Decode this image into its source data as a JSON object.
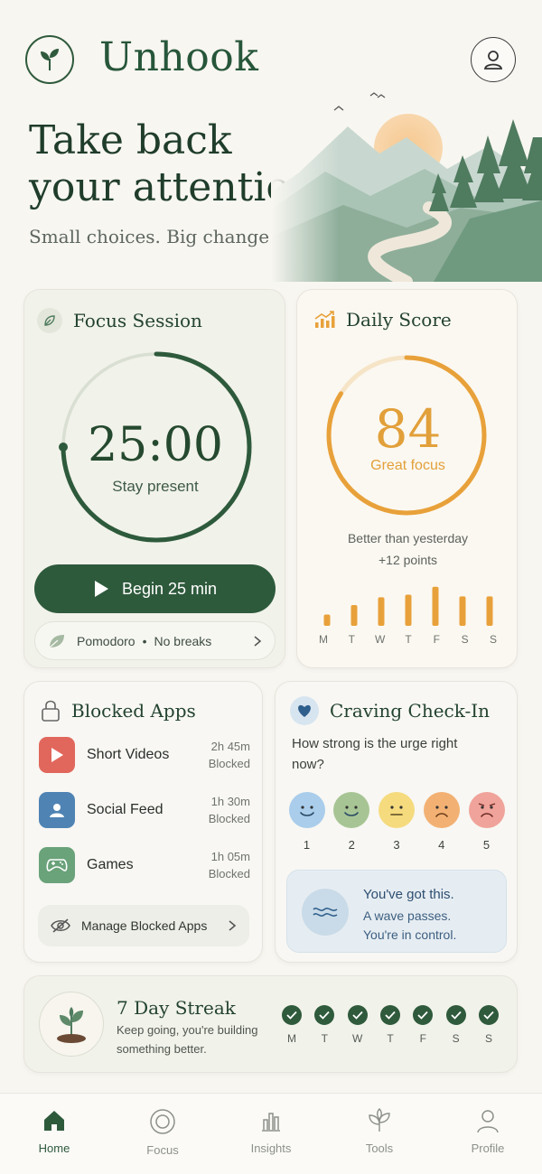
{
  "header": {
    "app_title": "Unhook",
    "logo_icon": "sprout-icon",
    "profile_icon": "user-icon"
  },
  "hero": {
    "title_line1": "Take back",
    "title_line2": "your attention",
    "subtitle": "Small choices. Big change."
  },
  "focus_session": {
    "title": "Focus Session",
    "timer": "25:00",
    "timer_caption": "Stay present",
    "progress_fraction": 0.75,
    "begin_label": "Begin 25 min",
    "mode": "Pomodoro",
    "mode_detail": "No breaks"
  },
  "daily_score": {
    "title": "Daily Score",
    "score": "84",
    "score_value": 84,
    "score_label": "Great focus",
    "comparison": "Better than yesterday",
    "delta": "+12 points",
    "days": [
      "M",
      "T",
      "W",
      "T",
      "F",
      "S",
      "S"
    ],
    "bar_values": [
      0.26,
      0.48,
      0.66,
      0.72,
      0.9,
      0.68,
      0.68
    ],
    "accent_color": "#e8a13a"
  },
  "blocked_apps": {
    "title": "Blocked Apps",
    "apps": [
      {
        "name": "Short Videos",
        "time": "2h 45m",
        "status": "Blocked",
        "icon": "play-icon",
        "color": "#e1675c"
      },
      {
        "name": "Social Feed",
        "time": "1h 30m",
        "status": "Blocked",
        "icon": "person-icon",
        "color": "#4f83b4"
      },
      {
        "name": "Games",
        "time": "1h 05m",
        "status": "Blocked",
        "icon": "gamepad-icon",
        "color": "#6aa27a"
      }
    ],
    "manage_label": "Manage Blocked Apps"
  },
  "craving": {
    "title": "Craving Check-In",
    "question": "How strong is the urge right now?",
    "levels": [
      {
        "n": "1",
        "color": "#a9cdeb",
        "mood": "happy"
      },
      {
        "n": "2",
        "color": "#a7c594",
        "mood": "happy"
      },
      {
        "n": "3",
        "color": "#f5db7e",
        "mood": "neutral"
      },
      {
        "n": "4",
        "color": "#f2b173",
        "mood": "sad"
      },
      {
        "n": "5",
        "color": "#f0a39a",
        "mood": "angry"
      }
    ],
    "encourage_title": "You've got this.",
    "encourage_line2": "A wave passes.",
    "encourage_line3": "You're in control."
  },
  "streak": {
    "title": "7 Day Streak",
    "subtitle": "Keep going, you're building something better.",
    "days": [
      "M",
      "T",
      "W",
      "T",
      "F",
      "S",
      "S"
    ]
  },
  "nav": {
    "items": [
      {
        "label": "Home",
        "icon": "home-icon",
        "active": true
      },
      {
        "label": "Focus",
        "icon": "target-icon",
        "active": false
      },
      {
        "label": "Insights",
        "icon": "bar-chart-icon",
        "active": false
      },
      {
        "label": "Tools",
        "icon": "plant-icon",
        "active": false
      },
      {
        "label": "Profile",
        "icon": "user-icon",
        "active": false
      }
    ]
  }
}
